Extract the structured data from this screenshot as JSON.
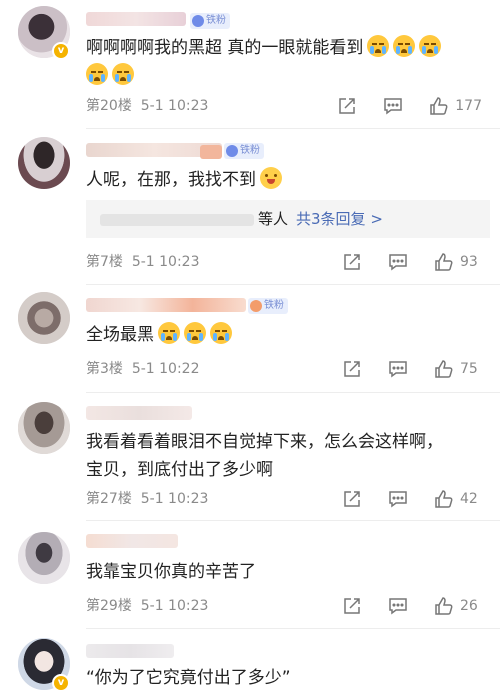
{
  "comments": [
    {
      "text": "啊啊啊啊我的黑超 真的一眼就能看到",
      "floor": "第20楼",
      "date": "5-1 10:23",
      "likes": "177",
      "badge": "铁粉",
      "emojis": [
        "cry-emoji",
        "cry-emoji",
        "cry-emoji",
        "cry-emoji",
        "cry-emoji"
      ]
    },
    {
      "text": "人呢，在那，我找不到",
      "floor": "第7楼",
      "date": "5-1 10:23",
      "likes": "93",
      "badge": "铁粉",
      "reply_suffix": "等人",
      "reply_link": "共3条回复 >",
      "emojis": [
        "shy-emoji"
      ]
    },
    {
      "text": "全场最黑",
      "floor": "第3楼",
      "date": "5-1 10:22",
      "likes": "75",
      "badge": "铁粉",
      "emojis": [
        "cry-emoji",
        "cry-emoji",
        "cry-emoji"
      ]
    },
    {
      "text_line1": "我看着看着眼泪不自觉掉下来，怎么会这样啊，",
      "text_line2": "宝贝，到底付出了多少啊",
      "floor": "第27楼",
      "date": "5-1 10:23",
      "likes": "42"
    },
    {
      "text": "我靠宝贝你真的辛苦了",
      "floor": "第29楼",
      "date": "5-1 10:23",
      "likes": "26"
    },
    {
      "text": "“你为了它究竟付出了多少”"
    }
  ],
  "colors": {
    "meta_gray": "#8a8a8a",
    "link_blue": "#4a6bb5",
    "vip_gold": "#f5b300"
  },
  "icons": [
    "share-icon",
    "comment-icon",
    "like-icon",
    "verified-v-icon"
  ]
}
